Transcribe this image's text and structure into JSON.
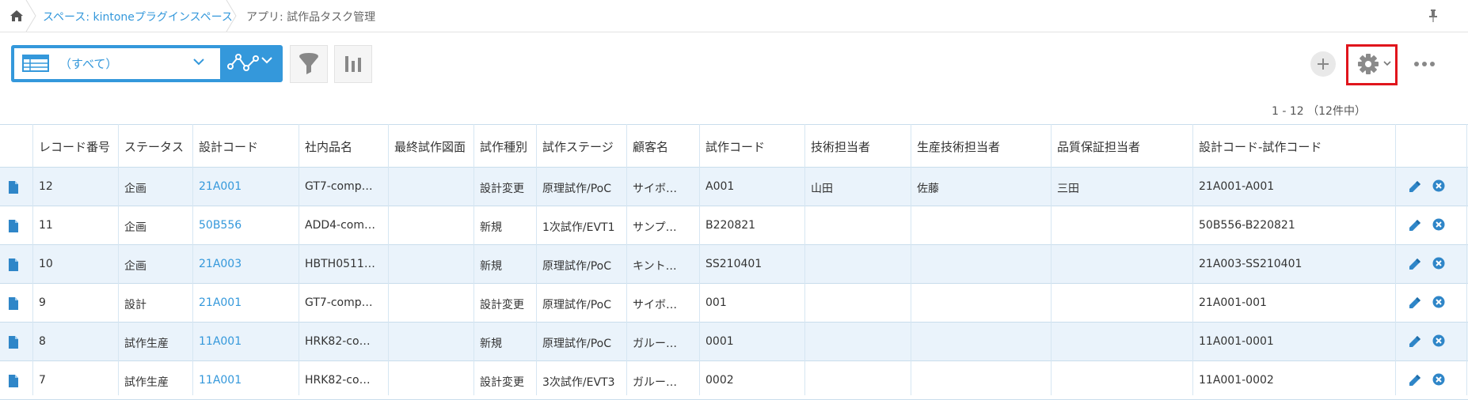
{
  "breadcrumb": {
    "space_label": "スペース: kintoneプラグインスペース",
    "app_label": "アプリ: 試作品タスク管理"
  },
  "toolbar": {
    "view_name": "（すべて）",
    "record_count": "1 - 12 （12件中）"
  },
  "icons": {
    "home": "home-icon",
    "pin": "pin-icon",
    "view": "table-view-icon",
    "graph": "graph-icon",
    "filter": "filter-icon",
    "chart": "bar-chart-icon",
    "add": "plus-icon",
    "settings": "gear-icon",
    "more": "more-icon",
    "record": "document-icon",
    "edit": "pencil-icon",
    "delete": "close-circle-icon"
  },
  "colors": {
    "accent": "#3498db",
    "highlight_border": "#e0151c",
    "row_alt": "#eaf3fb"
  },
  "table": {
    "headers": [
      "レコード番号",
      "ステータス",
      "設計コード",
      "社内品名",
      "最終試作図面",
      "試作種別",
      "試作ステージ",
      "顧客名",
      "試作コード",
      "技術担当者",
      "生産技術担当者",
      "品質保証担当者",
      "設計コード-試作コード"
    ],
    "rows": [
      [
        "12",
        "企画",
        "21A001",
        "GT7-comp…",
        "",
        "設計変更",
        "原理試作/PoC",
        "サイボ…",
        "A001",
        "山田",
        "佐藤",
        "三田",
        "21A001-A001"
      ],
      [
        "11",
        "企画",
        "50B556",
        "ADD4-com…",
        "",
        "新規",
        "1次試作/EVT1",
        "サンプ…",
        "B220821",
        "",
        "",
        "",
        "50B556-B220821"
      ],
      [
        "10",
        "企画",
        "21A003",
        "HBTH0511…",
        "",
        "新規",
        "原理試作/PoC",
        "キント…",
        "SS210401",
        "",
        "",
        "",
        "21A003-SS210401"
      ],
      [
        "9",
        "設計",
        "21A001",
        "GT7-comp…",
        "",
        "設計変更",
        "原理試作/PoC",
        "サイボ…",
        "001",
        "",
        "",
        "",
        "21A001-001"
      ],
      [
        "8",
        "試作生産",
        "11A001",
        "HRK82-co…",
        "",
        "新規",
        "原理試作/PoC",
        "ガルー…",
        "0001",
        "",
        "",
        "",
        "11A001-0001"
      ],
      [
        "7",
        "試作生産",
        "11A001",
        "HRK82-co…",
        "",
        "設計変更",
        "3次試作/EVT3",
        "ガルー…",
        "0002",
        "",
        "",
        "",
        "11A001-0002"
      ]
    ]
  }
}
